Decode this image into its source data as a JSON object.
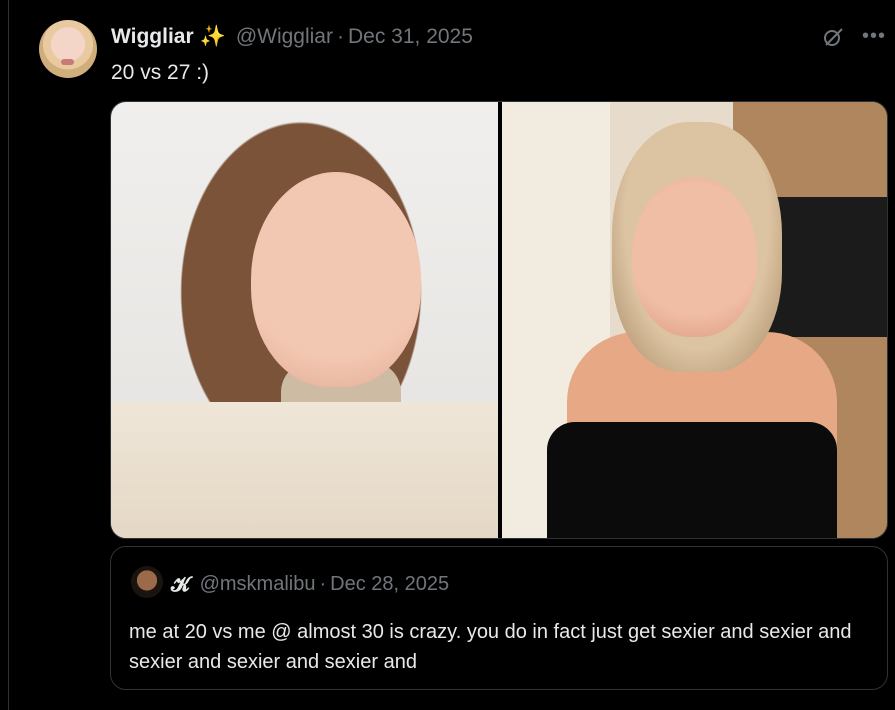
{
  "tweet": {
    "display_name": "Wiggliar",
    "emoji": "✨",
    "handle": "@Wiggliar",
    "separator": "·",
    "date": "Dec 31, 2025",
    "text": "20 vs 27 :)",
    "more_glyph": "•••"
  },
  "quoted_tweet": {
    "display_name": "𝓚",
    "handle": "@mskmalibu",
    "separator": "·",
    "date": "Dec 28, 2025",
    "text": "me at 20 vs me @ almost 30 is crazy. you do in fact just get sexier and sexier and sexier and sexier and sexier and"
  },
  "icons": {
    "sparkle": "sparkle-icon",
    "grok": "grok-icon",
    "more": "more-icon"
  },
  "colors": {
    "background": "#000000",
    "text_primary": "#e7e9ea",
    "text_secondary": "#71767b",
    "border": "#2f3336"
  }
}
